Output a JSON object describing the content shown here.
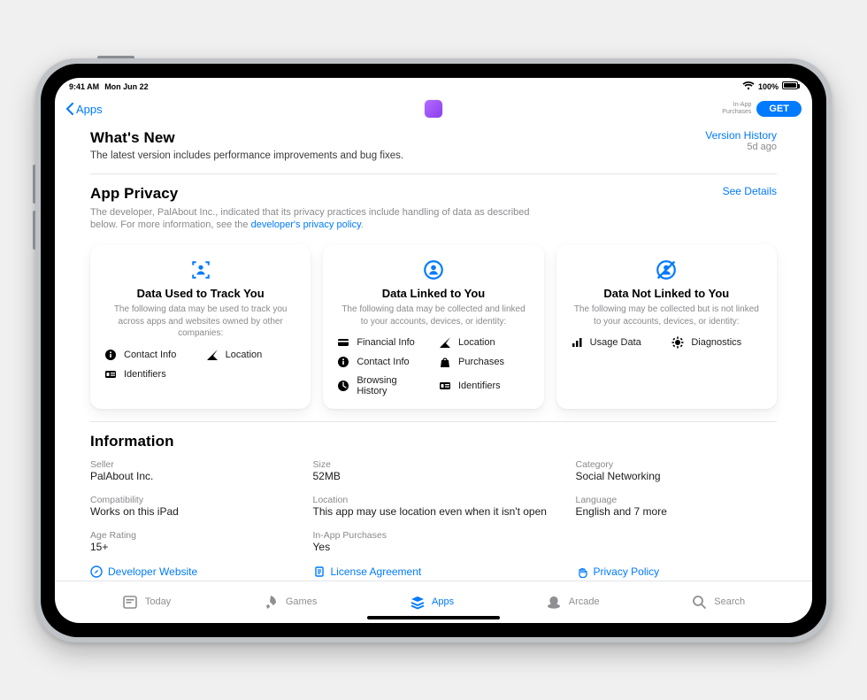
{
  "status": {
    "time": "9:41 AM",
    "date": "Mon Jun 22",
    "battery_pct": "100%"
  },
  "navbar": {
    "back_label": "Apps",
    "iap_label": "In-App\nPurchases",
    "get_label": "GET"
  },
  "whats_new": {
    "heading": "What's New",
    "body": "The latest version includes performance improvements and bug fixes.",
    "version_history_link": "Version History",
    "age": "5d ago"
  },
  "privacy": {
    "heading": "App Privacy",
    "see_details": "See Details",
    "desc_prefix": "The developer, PalAbout Inc., indicated that its privacy practices include handling of data as described below. For more information, see the ",
    "desc_link": "developer's privacy policy",
    "desc_suffix": ".",
    "cards": [
      {
        "title": "Data Used to Track You",
        "blurb": "The following data may be used to track you across apps and websites owned by other companies:",
        "items": [
          {
            "icon": "info",
            "label": "Contact Info"
          },
          {
            "icon": "location",
            "label": "Location"
          },
          {
            "icon": "id",
            "label": "Identifiers"
          }
        ]
      },
      {
        "title": "Data Linked to You",
        "blurb": "The following data may be collected and linked to your accounts, devices, or identity:",
        "items": [
          {
            "icon": "card",
            "label": "Financial Info"
          },
          {
            "icon": "location",
            "label": "Location"
          },
          {
            "icon": "info",
            "label": "Contact Info"
          },
          {
            "icon": "bag",
            "label": "Purchases"
          },
          {
            "icon": "clock",
            "label": "Browsing History"
          },
          {
            "icon": "id",
            "label": "Identifiers"
          }
        ]
      },
      {
        "title": "Data Not Linked to You",
        "blurb": "The following may be collected but is not linked to your accounts, devices, or identity:",
        "items": [
          {
            "icon": "bars",
            "label": "Usage Data"
          },
          {
            "icon": "gear",
            "label": "Diagnostics"
          }
        ]
      }
    ]
  },
  "information": {
    "heading": "Information",
    "rows": [
      [
        {
          "label": "Seller",
          "value": "PalAbout Inc."
        },
        {
          "label": "Size",
          "value": "52MB"
        },
        {
          "label": "Category",
          "value": "Social Networking"
        }
      ],
      [
        {
          "label": "Compatibility",
          "value": "Works on this iPad"
        },
        {
          "label": "Location",
          "value": "This app may use location even when it isn't open"
        },
        {
          "label": "Language",
          "value": "English and 7 more"
        }
      ],
      [
        {
          "label": "Age Rating",
          "value": "15+"
        },
        {
          "label": "In-App Purchases",
          "value": "Yes"
        },
        null
      ]
    ],
    "links": [
      {
        "icon": "compass",
        "label": "Developer Website"
      },
      {
        "icon": "doc",
        "label": "License Agreement"
      },
      {
        "icon": "hand",
        "label": "Privacy Policy"
      }
    ]
  },
  "tabs": [
    {
      "icon": "today",
      "label": "Today",
      "active": false
    },
    {
      "icon": "rocket",
      "label": "Games",
      "active": false
    },
    {
      "icon": "apps",
      "label": "Apps",
      "active": true
    },
    {
      "icon": "arcade",
      "label": "Arcade",
      "active": false
    },
    {
      "icon": "search",
      "label": "Search",
      "active": false
    }
  ]
}
